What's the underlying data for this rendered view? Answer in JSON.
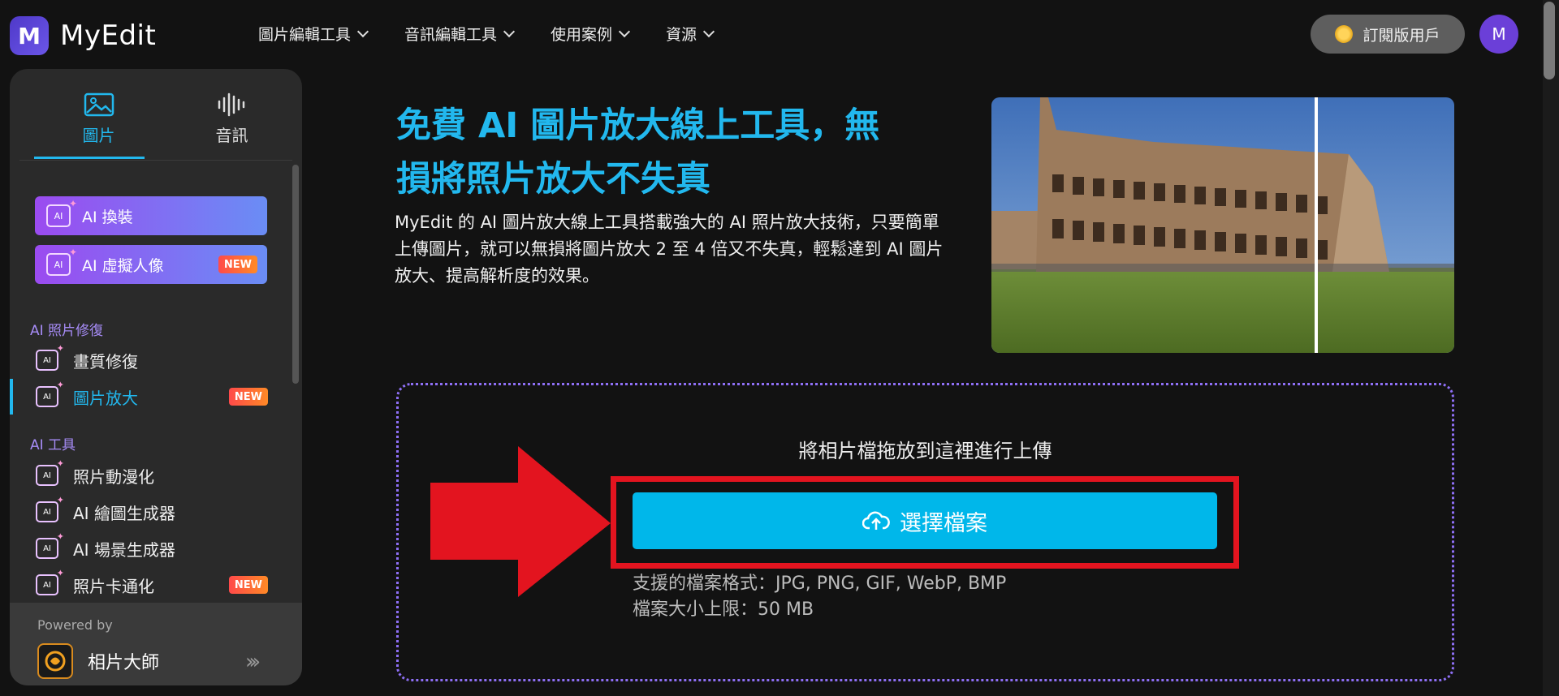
{
  "header": {
    "logo_text": "MyEdit",
    "nav": [
      {
        "label": "圖片編輯工具"
      },
      {
        "label": "音訊編輯工具"
      },
      {
        "label": "使用案例"
      },
      {
        "label": "資源"
      }
    ],
    "subscription_label": "訂閱版用戶",
    "avatar_initial": "M"
  },
  "sidebar": {
    "tabs": [
      {
        "label": "圖片",
        "active": true
      },
      {
        "label": "音訊",
        "active": false
      }
    ],
    "promos": [
      {
        "label": "AI 換裝",
        "badge": ""
      },
      {
        "label": "AI 虛擬人像",
        "badge": "NEW"
      }
    ],
    "sections": [
      {
        "title": "AI 照片修復",
        "items": [
          {
            "label": "畫質修復",
            "badge": ""
          },
          {
            "label": "圖片放大",
            "badge": "NEW",
            "active": true
          }
        ]
      },
      {
        "title": "AI 工具",
        "items": [
          {
            "label": "照片動漫化",
            "badge": ""
          },
          {
            "label": "AI 繪圖生成器",
            "badge": ""
          },
          {
            "label": "AI 場景生成器",
            "badge": ""
          },
          {
            "label": "照片卡通化",
            "badge": "NEW"
          }
        ]
      }
    ],
    "powered_by_label": "Powered by",
    "powered_by_name": "相片大師"
  },
  "main": {
    "headline_line1": "免費 AI 圖片放大線上工具，無",
    "headline_line2": "損將照片放大不失真",
    "description": "MyEdit 的 AI 圖片放大線上工具搭載強大的 AI 照片放大技術，只要簡單上傳圖片，就可以無損將圖片放大 2 至 4 倍又不失真，輕鬆達到 AI 圖片放大、提高解析度的效果。",
    "drop_text": "將相片檔拖放到這裡進行上傳",
    "choose_file_label": "選擇檔案",
    "supported_formats": "支援的檔案格式：JPG, PNG, GIF, WebP, BMP",
    "max_size": "檔案大小上限：50 MB"
  },
  "colors": {
    "accent": "#22b8ee",
    "button": "#00b7ea",
    "highlight": "#e3141f",
    "section_title": "#a78cf7",
    "background": "#121212",
    "sidebar": "#2a2a2a"
  }
}
